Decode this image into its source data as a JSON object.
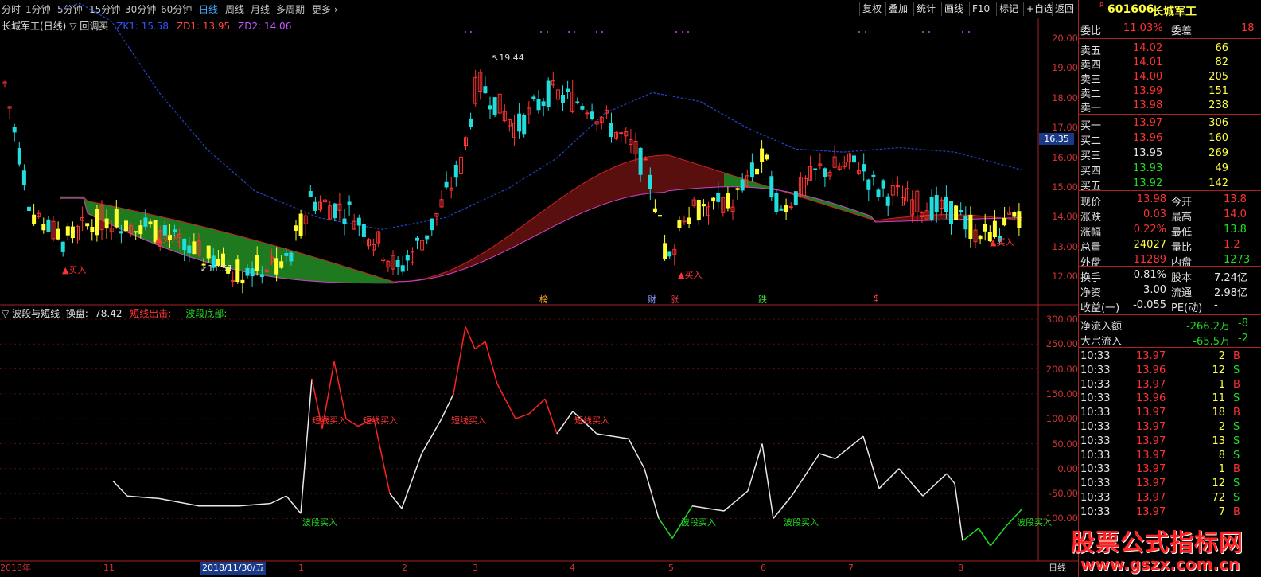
{
  "toolbar": {
    "periods": [
      "分时",
      "1分钟",
      "5分钟",
      "15分钟",
      "30分钟",
      "60分钟",
      "日线",
      "周线",
      "月线",
      "多周期",
      "更多"
    ],
    "active_period": "日线",
    "buttons": [
      "复权",
      "叠加",
      "统计",
      "画线",
      "F10",
      "标记",
      "+自选",
      "返回"
    ]
  },
  "main_chart": {
    "title": "长城军工(日线)",
    "indicator_name": "回调买",
    "zk1": "ZK1: 15.58",
    "zd1": "ZD1: 13.95",
    "zd2": "ZD2: 14.06",
    "price_axis": [
      "20.00",
      "19.00",
      "18.00",
      "17.00",
      "16.00",
      "15.00",
      "14.00",
      "13.00",
      "12.00"
    ],
    "current_price_tag": "16.35",
    "high_label": "19.44",
    "low_label": "11.51",
    "buy_label": "买入",
    "event_markers": [
      "榜",
      "财",
      "涨",
      "跌",
      "$"
    ]
  },
  "sub_chart": {
    "title": "波段与短线",
    "op_label": "操盘:",
    "op_value": "-78.42",
    "short_exit": "短线出击: -",
    "band_bottom": "波段底部: -",
    "axis": [
      "300.00",
      "250.00",
      "200.00",
      "150.00",
      "100.00",
      "50.00",
      "0.00",
      "-50.00",
      "-100.00"
    ],
    "band_buy_label": "波段买入",
    "short_buy_label": "短线买入"
  },
  "date_axis": [
    "2018年",
    "11",
    "2018/11/30/五",
    "1",
    "2",
    "3",
    "4",
    "5",
    "6",
    "7",
    "8",
    "日线"
  ],
  "right_panel": {
    "code": "601606",
    "name": "长城军工",
    "weibi_label": "委比",
    "weibi_value": "11.03%",
    "weicha_label": "委差",
    "weicha_value": "18",
    "sells": [
      {
        "label": "卖五",
        "price": "14.02",
        "vol": "66"
      },
      {
        "label": "卖四",
        "price": "14.01",
        "vol": "82"
      },
      {
        "label": "卖三",
        "price": "14.00",
        "vol": "205"
      },
      {
        "label": "卖二",
        "price": "13.99",
        "vol": "151"
      },
      {
        "label": "卖一",
        "price": "13.98",
        "vol": "238"
      }
    ],
    "buys": [
      {
        "label": "买一",
        "price": "13.97",
        "vol": "306"
      },
      {
        "label": "买二",
        "price": "13.96",
        "vol": "160"
      },
      {
        "label": "买三",
        "price": "13.95",
        "vol": "269"
      },
      {
        "label": "买四",
        "price": "13.93",
        "vol": "49"
      },
      {
        "label": "买五",
        "price": "13.92",
        "vol": "142"
      }
    ],
    "stats": [
      {
        "l1": "现价",
        "v1": "13.98",
        "l2": "今开",
        "v2": "13.8"
      },
      {
        "l1": "涨跌",
        "v1": "0.03",
        "l2": "最高",
        "v2": "14.0"
      },
      {
        "l1": "涨幅",
        "v1": "0.22%",
        "l2": "最低",
        "v2": "13.8"
      },
      {
        "l1": "总量",
        "v1": "24027",
        "l2": "量比",
        "v2": "1.2"
      },
      {
        "l1": "外盘",
        "v1": "11289",
        "l2": "内盘",
        "v2": "1273"
      }
    ],
    "stats2": [
      {
        "l1": "换手",
        "v1": "0.81%",
        "l2": "股本",
        "v2": "7.24亿"
      },
      {
        "l1": "净资",
        "v1": "3.00",
        "l2": "流通",
        "v2": "2.98亿"
      },
      {
        "l1": "收益(一)",
        "v1": "-0.055",
        "l2": "PE(动)",
        "v2": "-"
      }
    ],
    "flows": [
      {
        "label": "净流入额",
        "value": "-266.2万",
        "extra": "-8"
      },
      {
        "label": "大宗流入",
        "value": "-65.5万",
        "extra": "-2"
      }
    ],
    "ticks": [
      {
        "time": "10:33",
        "price": "13.97",
        "vol": "2",
        "side": "B"
      },
      {
        "time": "10:33",
        "price": "13.96",
        "vol": "12",
        "side": "S"
      },
      {
        "time": "10:33",
        "price": "13.97",
        "vol": "1",
        "side": "B"
      },
      {
        "time": "10:33",
        "price": "13.96",
        "vol": "11",
        "side": "S"
      },
      {
        "time": "10:33",
        "price": "13.97",
        "vol": "18",
        "side": "B"
      },
      {
        "time": "10:33",
        "price": "13.97",
        "vol": "2",
        "side": "S"
      },
      {
        "time": "10:33",
        "price": "13.97",
        "vol": "13",
        "side": "S"
      },
      {
        "time": "10:33",
        "price": "13.97",
        "vol": "8",
        "side": "S"
      },
      {
        "time": "10:33",
        "price": "13.97",
        "vol": "1",
        "side": "B"
      },
      {
        "time": "10:33",
        "price": "13.97",
        "vol": "12",
        "side": "S"
      },
      {
        "time": "10:33",
        "price": "13.97",
        "vol": "72",
        "side": "S"
      },
      {
        "time": "10:33",
        "price": "13.97",
        "vol": "7",
        "side": "B"
      }
    ]
  },
  "watermark": {
    "line1": "股票公式指标网",
    "line2": "www.gszx.com.cn"
  },
  "colors": {
    "up": "#ff3333",
    "down": "#22dddd",
    "yellow": "#ffff33",
    "ribbon_green": "#1f7a1f",
    "ribbon_red": "#5a0f0f"
  }
}
